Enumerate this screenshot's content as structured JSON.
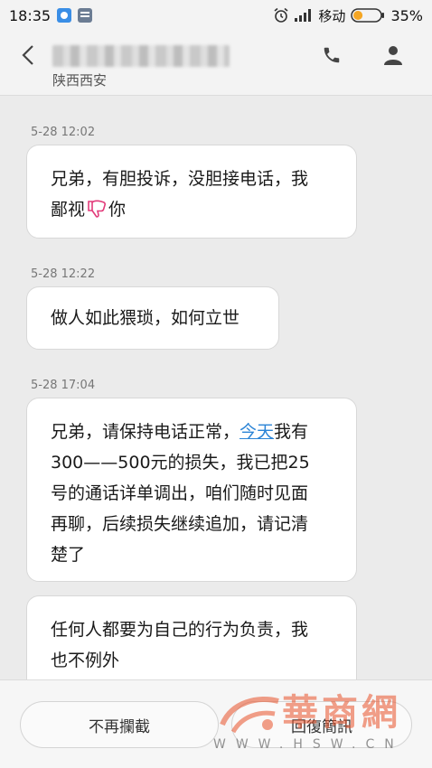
{
  "status_bar": {
    "time": "18:35",
    "carrier": "移动",
    "battery": "35%",
    "icons": [
      "app-icon-blue",
      "app-icon-slate",
      "alarm-icon",
      "signal-icon",
      "battery-icon"
    ]
  },
  "header": {
    "contact_location": "陕西西安",
    "icons": [
      "back-icon",
      "phone-icon",
      "person-icon"
    ]
  },
  "messages": [
    {
      "time": "5-28 12:02",
      "text_before": "兄弟，有胆投诉，没胆接电话，我",
      "text_line2_before": "鄙视",
      "emoji": "thumb-down-icon",
      "text_after": "你"
    },
    {
      "time": "5-28 12:22",
      "text": "做人如此猥琐，如何立世"
    },
    {
      "time": "5-28 17:04",
      "text_before": "兄弟，请保持电话正常，",
      "link": "今天",
      "text_after": "我有",
      "lines": [
        "300——500元的损失，我已把25",
        "号的通话详单调出，咱们随时见面",
        "再聊，后续损失继续追加，请记清",
        "楚了"
      ]
    },
    {
      "time": "",
      "lines": [
        "任何人都要为自己的行为负责，我",
        "也不例外"
      ]
    }
  ],
  "bottom_bar": {
    "unblock_label": "不再攔截",
    "reply_label": "回復簡訊"
  },
  "watermark": {
    "brand": "華商網",
    "url": "WWW.HSW.CN"
  },
  "colors": {
    "link": "#2b84d6",
    "battery_fill": "#f5a623",
    "emoji": "#e23b7a",
    "watermark": "#e85028"
  }
}
